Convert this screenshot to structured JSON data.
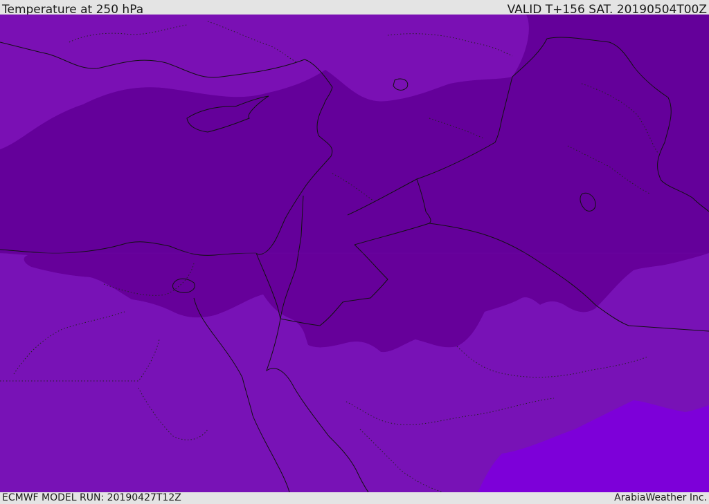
{
  "header": {
    "title": "Temperature at 250 hPa",
    "valid": "VALID T+156 SAT. 20190504T00Z"
  },
  "footer": {
    "model_run": "ECMWF MODEL RUN: 20190427T12Z",
    "credit": "ArabiaWeather Inc."
  },
  "map": {
    "variable": "temperature",
    "level": "250 hPa",
    "colors": {
      "band_warm": "#7a10b4",
      "band_cold": "#66009a",
      "band_coldest": "#5e008e",
      "band_warmest": "#7d00d9",
      "borders": "#111111"
    }
  }
}
